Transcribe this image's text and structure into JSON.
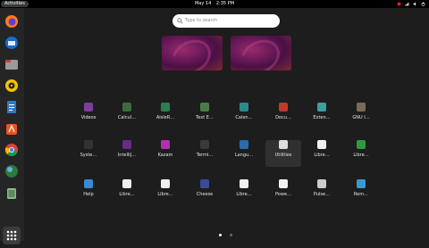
{
  "topbar": {
    "activities_label": "Activities",
    "date": "May 14",
    "time": "2:35 PM"
  },
  "search": {
    "placeholder": "Type to search"
  },
  "apps_row1": [
    {
      "label": "Videos",
      "icon": "videos-icon",
      "color": "#7b3f9a"
    },
    {
      "label": "Calcul…",
      "icon": "calculator-icon",
      "color": "#3d6b3d"
    },
    {
      "label": "AisleR…",
      "icon": "aisleriot-icon",
      "color": "#2e7d4f"
    },
    {
      "label": "Text E…",
      "icon": "text-editor-icon",
      "color": "#4a7c4a"
    },
    {
      "label": "Calen…",
      "icon": "calendar-icon",
      "color": "#2e8a8a"
    },
    {
      "label": "Docu…",
      "icon": "document-viewer-icon",
      "color": "#c0392b"
    },
    {
      "label": "Exten…",
      "icon": "extensions-icon",
      "color": "#3aa0a0"
    },
    {
      "label": "GNU I…",
      "icon": "gnu-image-icon",
      "color": "#7a6a5a"
    }
  ],
  "apps_row2": [
    {
      "label": "Syste…",
      "icon": "system-monitor-icon",
      "color": "#333333"
    },
    {
      "label": "IntelliJ…",
      "icon": "intellij-icon",
      "color": "#6a2a8a"
    },
    {
      "label": "Kazam",
      "icon": "kazam-icon",
      "color": "#b030b0"
    },
    {
      "label": "Termi…",
      "icon": "terminal-icon",
      "color": "#3a3a3a"
    },
    {
      "label": "Langu…",
      "icon": "language-support-icon",
      "color": "#2a6ab0"
    },
    {
      "label": "Utilities",
      "icon": "utilities-icon",
      "color": "#dddddd"
    },
    {
      "label": "Libre…",
      "icon": "libreoffice-icon",
      "color": "#f0f0f0"
    },
    {
      "label": "Libre…",
      "icon": "libreoffice-calc-icon",
      "color": "#2e9a3e"
    }
  ],
  "apps_row3": [
    {
      "label": "Help",
      "icon": "help-icon",
      "color": "#3a8ad0"
    },
    {
      "label": "Libre…",
      "icon": "libreoffice-icon",
      "color": "#f0f0f0"
    },
    {
      "label": "Libre…",
      "icon": "libreoffice-writer-icon",
      "color": "#f0f0f0"
    },
    {
      "label": "Cheese",
      "icon": "cheese-icon",
      "color": "#3a4a9a"
    },
    {
      "label": "Libre…",
      "icon": "libreoffice-impress-icon",
      "color": "#f0f0f0"
    },
    {
      "label": "Powe…",
      "icon": "power-statistics-icon",
      "color": "#f0f0f0"
    },
    {
      "label": "Pulse…",
      "icon": "pulseaudio-icon",
      "color": "#cccccc"
    },
    {
      "label": "Rem…",
      "icon": "remmina-icon",
      "color": "#3a9ad0"
    }
  ],
  "colors": {
    "background": "#1d1d1d",
    "dock": "#252525",
    "topbar": "#000000",
    "accent_red": "#e01b24"
  }
}
